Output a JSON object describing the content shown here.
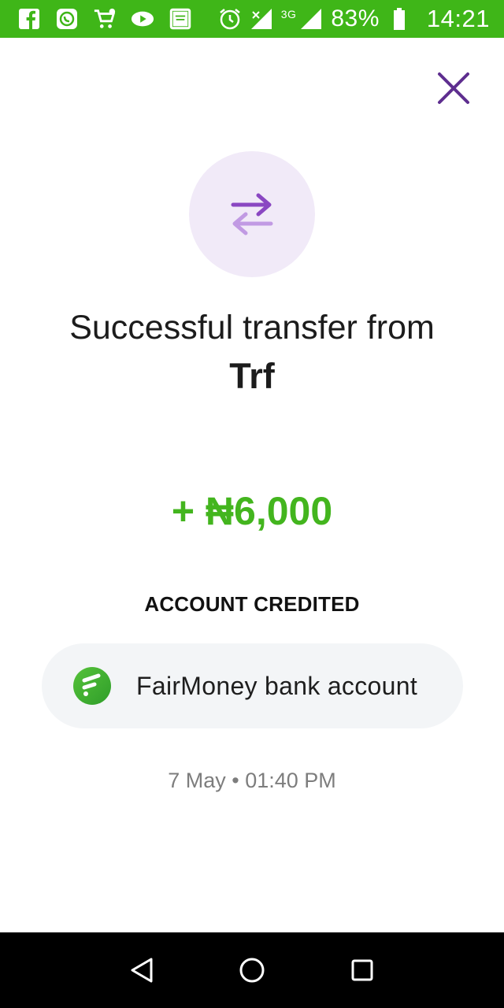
{
  "status_bar": {
    "battery": "83%",
    "network": "3G",
    "time": "14:21",
    "icons": [
      "facebook-icon",
      "whatsapp-icon",
      "shopping-cart-icon",
      "play-icon",
      "bible-icon",
      "alarm-icon",
      "signal-icon",
      "battery-icon"
    ]
  },
  "header": {
    "close_icon": "close-icon"
  },
  "transfer": {
    "icon": "transfer-arrows-icon",
    "title_line1": "Successful transfer from",
    "title_line2": "Trf",
    "amount": "+ ₦6,000"
  },
  "credited": {
    "label": "ACCOUNT CREDITED",
    "account_name": "FairMoney bank account",
    "logo": "fairmoney-logo-icon"
  },
  "datetime": "7 May • 01:40 PM",
  "nav": [
    "back-icon",
    "home-icon",
    "recents-icon"
  ],
  "colors": {
    "status_bar": "#3fb618",
    "amount": "#43b51e",
    "accent_purple": "#7b3fb4",
    "circle_bg": "#f1eaf8",
    "pill_bg": "#f3f5f7"
  }
}
